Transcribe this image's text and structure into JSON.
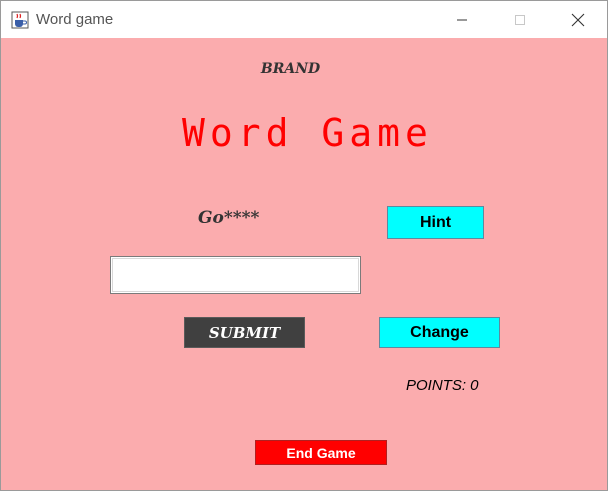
{
  "window": {
    "title": "Word game",
    "icon": "java-cup-icon",
    "controls": [
      "minimize-icon",
      "maximize-icon",
      "close-icon"
    ]
  },
  "game": {
    "brand": "BRAND",
    "heading": "Word Game",
    "masked_word": "Go****",
    "answer_value": "",
    "points_label": "POINTS: 0"
  },
  "buttons": {
    "hint": "Hint",
    "submit": "SUBMIT",
    "change": "Change",
    "end_game": "End Game"
  },
  "colors": {
    "background": "#fbacae",
    "heading": "#ff0000",
    "hint_button": "#00ffff",
    "change_button": "#00ffff",
    "submit_button": "#404040",
    "end_game_button": "#ff0000"
  }
}
